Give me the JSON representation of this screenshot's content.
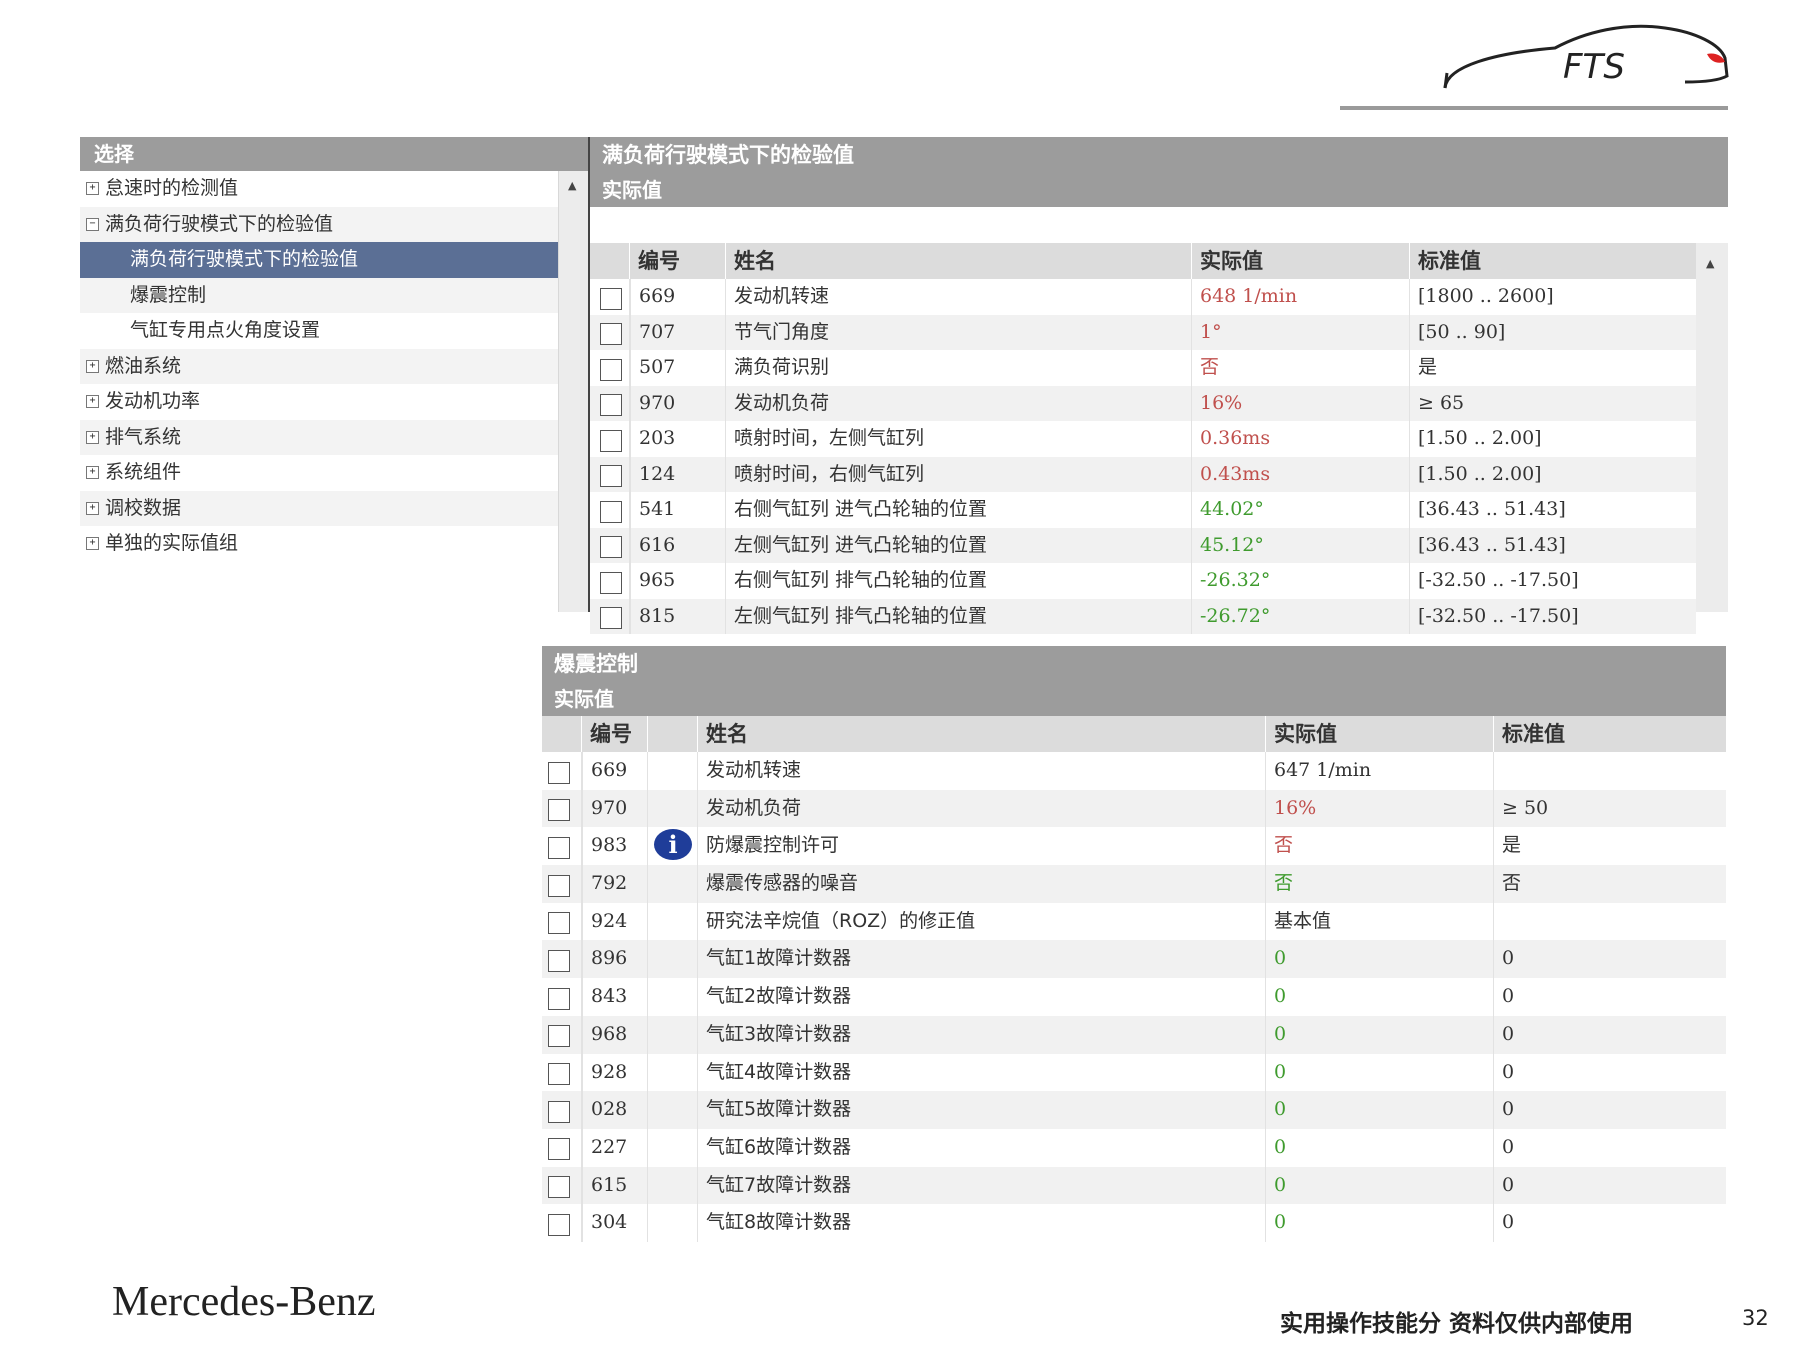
{
  "logo": {
    "text": "FTS"
  },
  "tree": {
    "header": "选择",
    "items": [
      {
        "label": "怠速时的检测值",
        "expander": "+",
        "level": 1,
        "selected": false
      },
      {
        "label": "满负荷行驶模式下的检验值",
        "expander": "−",
        "level": 1,
        "selected": false
      },
      {
        "label": "满负荷行驶模式下的检验值",
        "expander": "",
        "level": 2,
        "selected": true
      },
      {
        "label": "爆震控制",
        "expander": "",
        "level": 2,
        "selected": false
      },
      {
        "label": "气缸专用点火角度设置",
        "expander": "",
        "level": 2,
        "selected": false
      },
      {
        "label": "燃油系统",
        "expander": "+",
        "level": 1,
        "selected": false
      },
      {
        "label": "发动机功率",
        "expander": "+",
        "level": 1,
        "selected": false
      },
      {
        "label": "排气系统",
        "expander": "+",
        "level": 1,
        "selected": false
      },
      {
        "label": "系统组件",
        "expander": "+",
        "level": 1,
        "selected": false
      },
      {
        "label": "调校数据",
        "expander": "+",
        "level": 1,
        "selected": false
      },
      {
        "label": "单独的实际值组",
        "expander": "+",
        "level": 1,
        "selected": false
      }
    ]
  },
  "panel1": {
    "title": "满负荷行驶模式下的检验值",
    "subtitle": "实际值",
    "columns": [
      "编号",
      "姓名",
      "实际值",
      "标准值"
    ],
    "rows": [
      {
        "id": "669",
        "name": "发动机转速",
        "actual": "648 1/min",
        "standard": "[1800 .. 2600]",
        "status": "red"
      },
      {
        "id": "707",
        "name": "节气门角度",
        "actual": "1°",
        "standard": "[50 .. 90]",
        "status": "red"
      },
      {
        "id": "507",
        "name": "满负荷识别",
        "actual": "否",
        "standard": "是",
        "status": "red"
      },
      {
        "id": "970",
        "name": "发动机负荷",
        "actual": "16%",
        "standard": "≥ 65",
        "status": "red"
      },
      {
        "id": "203",
        "name": "喷射时间，左侧气缸列",
        "actual": "0.36ms",
        "standard": "[1.50 .. 2.00]",
        "status": "red"
      },
      {
        "id": "124",
        "name": "喷射时间，右侧气缸列",
        "actual": "0.43ms",
        "standard": "[1.50 .. 2.00]",
        "status": "red"
      },
      {
        "id": "541",
        "name": "右侧气缸列 进气凸轮轴的位置",
        "actual": "44.02°",
        "standard": "[36.43 .. 51.43]",
        "status": "green"
      },
      {
        "id": "616",
        "name": "左侧气缸列 进气凸轮轴的位置",
        "actual": "45.12°",
        "standard": "[36.43 .. 51.43]",
        "status": "green"
      },
      {
        "id": "965",
        "name": "右侧气缸列 排气凸轮轴的位置",
        "actual": "-26.32°",
        "standard": "[-32.50 .. -17.50]",
        "status": "green"
      },
      {
        "id": "815",
        "name": "左侧气缸列 排气凸轮轴的位置",
        "actual": "-26.72°",
        "standard": "[-32.50 .. -17.50]",
        "status": "green"
      }
    ]
  },
  "panel2": {
    "title": "爆震控制",
    "subtitle": "实际值",
    "columns": [
      "编号",
      "姓名",
      "实际值",
      "标准值"
    ],
    "rows": [
      {
        "id": "669",
        "name": "发动机转速",
        "actual": "647 1/min",
        "standard": "",
        "status": "normal",
        "info": false
      },
      {
        "id": "970",
        "name": "发动机负荷",
        "actual": "16%",
        "standard": "≥ 50",
        "status": "red",
        "info": false
      },
      {
        "id": "983",
        "name": "防爆震控制许可",
        "actual": "否",
        "standard": "是",
        "status": "red",
        "info": true
      },
      {
        "id": "792",
        "name": "爆震传感器的噪音",
        "actual": "否",
        "standard": "否",
        "status": "green",
        "info": false
      },
      {
        "id": "924",
        "name": "研究法辛烷值（ROZ）的修正值",
        "actual": "基本值",
        "standard": "",
        "status": "normal",
        "info": false
      },
      {
        "id": "896",
        "name": "气缸1故障计数器",
        "actual": "0",
        "standard": "0",
        "status": "green",
        "info": false
      },
      {
        "id": "843",
        "name": "气缸2故障计数器",
        "actual": "0",
        "standard": "0",
        "status": "green",
        "info": false
      },
      {
        "id": "968",
        "name": "气缸3故障计数器",
        "actual": "0",
        "standard": "0",
        "status": "green",
        "info": false
      },
      {
        "id": "928",
        "name": "气缸4故障计数器",
        "actual": "0",
        "standard": "0",
        "status": "green",
        "info": false
      },
      {
        "id": "028",
        "name": "气缸5故障计数器",
        "actual": "0",
        "standard": "0",
        "status": "green",
        "info": false
      },
      {
        "id": "227",
        "name": "气缸6故障计数器",
        "actual": "0",
        "standard": "0",
        "status": "green",
        "info": false
      },
      {
        "id": "615",
        "name": "气缸7故障计数器",
        "actual": "0",
        "standard": "0",
        "status": "green",
        "info": false
      },
      {
        "id": "304",
        "name": "气缸8故障计数器",
        "actual": "0",
        "standard": "0",
        "status": "green",
        "info": false
      }
    ]
  },
  "footer": {
    "brand": "Mercedes-Benz",
    "note": "实用操作技能分 资料仅供内部使用",
    "page": "32"
  },
  "colors": {
    "header_gray": "#9c9c9c",
    "selected": "#5b6f95",
    "red": "#c0504d",
    "green": "#3f9b2e"
  }
}
